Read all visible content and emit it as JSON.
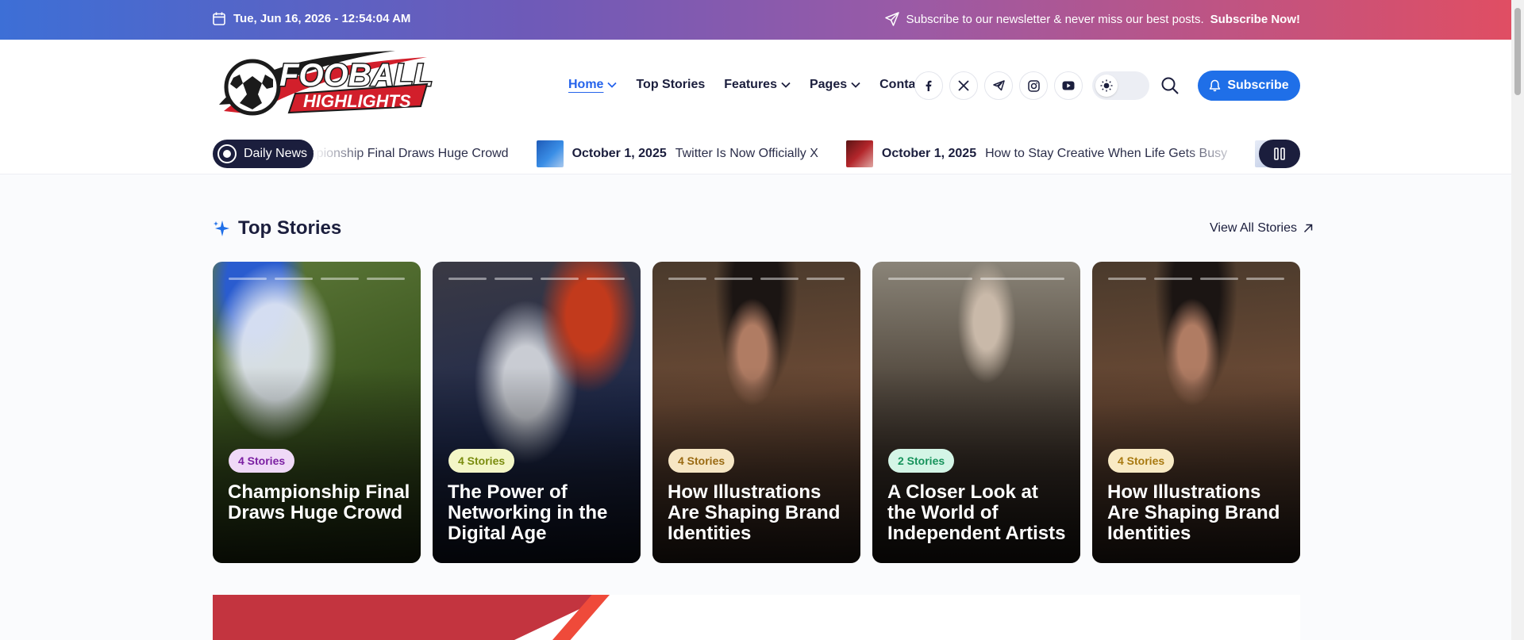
{
  "topbar": {
    "datetime": "Tue, Jun 16, 2026 - 12:54:04 AM",
    "newsletter_text": "Subscribe to our newsletter & never miss our best posts.",
    "newsletter_cta": "Subscribe Now!"
  },
  "logo": {
    "line1": "FOOBALL",
    "line2": "HIGHLIGHTS"
  },
  "nav": {
    "items": [
      {
        "label": "Home",
        "dropdown": true,
        "active": true
      },
      {
        "label": "Top Stories",
        "dropdown": false
      },
      {
        "label": "Features",
        "dropdown": true
      },
      {
        "label": "Pages",
        "dropdown": true
      },
      {
        "label": "Contact",
        "dropdown": false
      }
    ]
  },
  "social": [
    "facebook-icon",
    "x-icon",
    "telegram-icon",
    "instagram-icon",
    "youtube-icon"
  ],
  "header": {
    "subscribe_label": "Subscribe"
  },
  "ticker": {
    "badge": "Daily News",
    "items": [
      {
        "date": "",
        "title": "Championship Final Draws Huge Crowd"
      },
      {
        "date": "October 1, 2025",
        "title": "Twitter Is Now Officially X"
      },
      {
        "date": "October 1, 2025",
        "title": "How to Stay Creative When Life Gets Busy"
      }
    ]
  },
  "section": {
    "title": "Top Stories",
    "view_all": "View All Stories"
  },
  "cards": [
    {
      "pill": "4 Stories",
      "title": "Championship Final Draws Huge Crowd",
      "pill_bg": "#efd9f7",
      "pill_fg": "#7b1fa2"
    },
    {
      "pill": "4 Stories",
      "title": "The Power of Networking in the Digital Age",
      "pill_bg": "#f3f6c7",
      "pill_fg": "#7a8c0e"
    },
    {
      "pill": "4 Stories",
      "title": "How Illustrations Are Shaping Brand Identities",
      "pill_bg": "#f6e6c4",
      "pill_fg": "#9a6a12"
    },
    {
      "pill": "2 Stories",
      "title": "A Closer Look at the World of Independent Artists",
      "pill_bg": "#d4f5e6",
      "pill_fg": "#16935b"
    },
    {
      "pill": "4 Stories",
      "title": "How Illustrations Are Shaping Brand Identities",
      "pill_bg": "#f8eac4",
      "pill_fg": "#a8790f"
    }
  ],
  "colors": {
    "accent": "#1f6fe8",
    "dark": "#1b1e3d"
  }
}
